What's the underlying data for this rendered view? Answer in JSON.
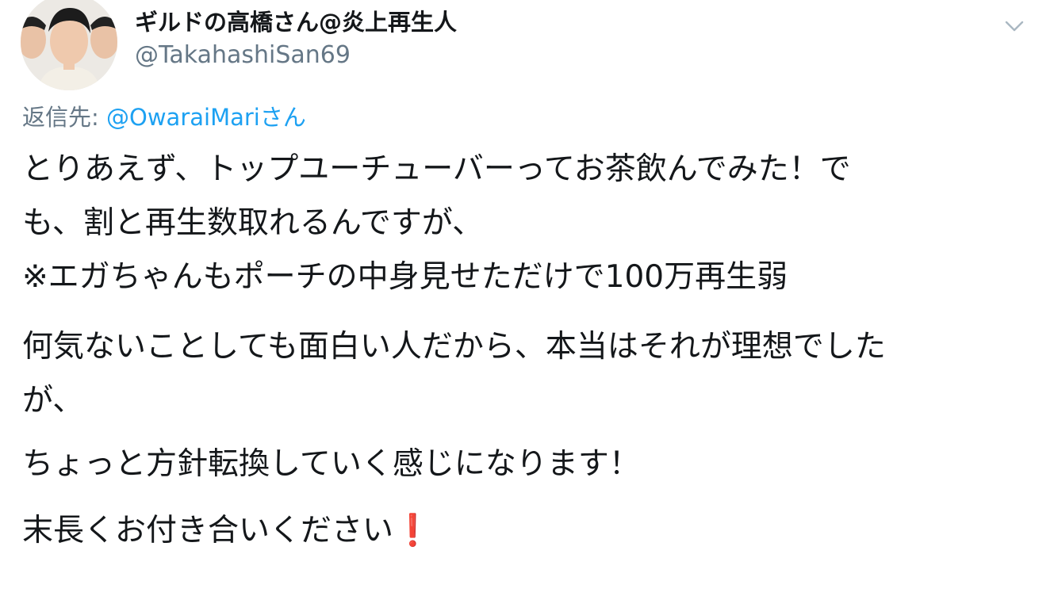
{
  "tweet": {
    "author": {
      "name": "ギルドの高橋さん@炎上再生人",
      "handle": "@TakahashiSan69"
    },
    "menu_icon": "chevron-down-icon",
    "reply": {
      "prefix": "返信先: ",
      "mention": "@OwaraiMari",
      "suffix": "さん"
    },
    "paragraphs": [
      {
        "lines": [
          "とりあえず、トップユーチューバーってお茶飲んでみた！で",
          "も、割と再生数取れるんですが、",
          "※エガちゃんもポーチの中身見せただけで100万再生弱"
        ]
      },
      {
        "lines": [
          "何気ないことしても面白い人だから、本当はそれが理想でした",
          "が、"
        ]
      },
      {
        "lines": [
          "ちょっと方針転換していく感じになります！"
        ]
      },
      {
        "lines": [
          "末長くお付き合いください"
        ],
        "trailing_emoji": "❗"
      }
    ],
    "colors": {
      "text": "#14171a",
      "secondary": "#657786",
      "link": "#1da1f2",
      "emoji": "#d9261c"
    }
  }
}
